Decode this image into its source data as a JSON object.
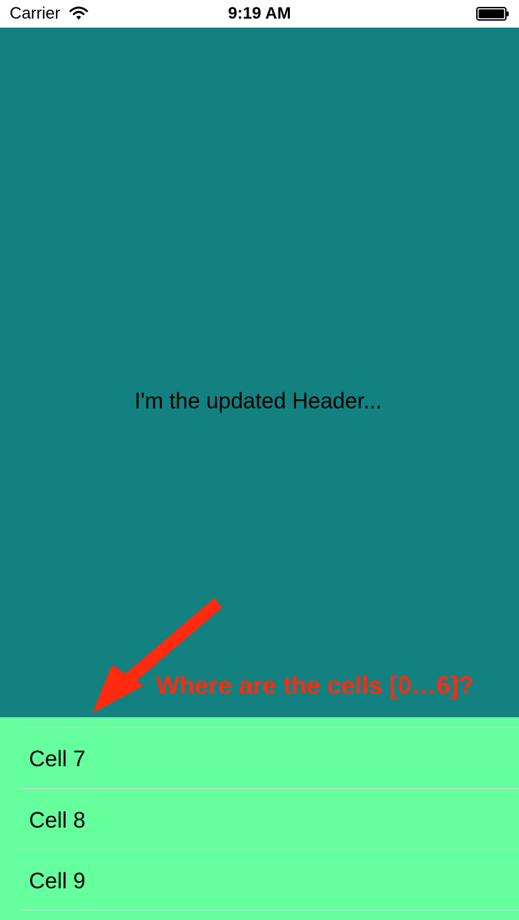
{
  "status_bar": {
    "carrier": "Carrier",
    "time": "9:19 AM",
    "wifi_icon": "wifi-icon",
    "battery_icon": "battery-icon"
  },
  "header": {
    "text": "I'm the updated Header...",
    "background_color": "#128180"
  },
  "annotation": {
    "text": "Where are the cells [0…6]?",
    "color": "#ff2a0f",
    "arrow_icon": "arrow-down-left-icon"
  },
  "table": {
    "background_color": "#66ff9e",
    "separator_color": "#d6d6d6",
    "cells": [
      {
        "label": "Cell 7"
      },
      {
        "label": "Cell 8"
      },
      {
        "label": "Cell 9"
      }
    ]
  }
}
